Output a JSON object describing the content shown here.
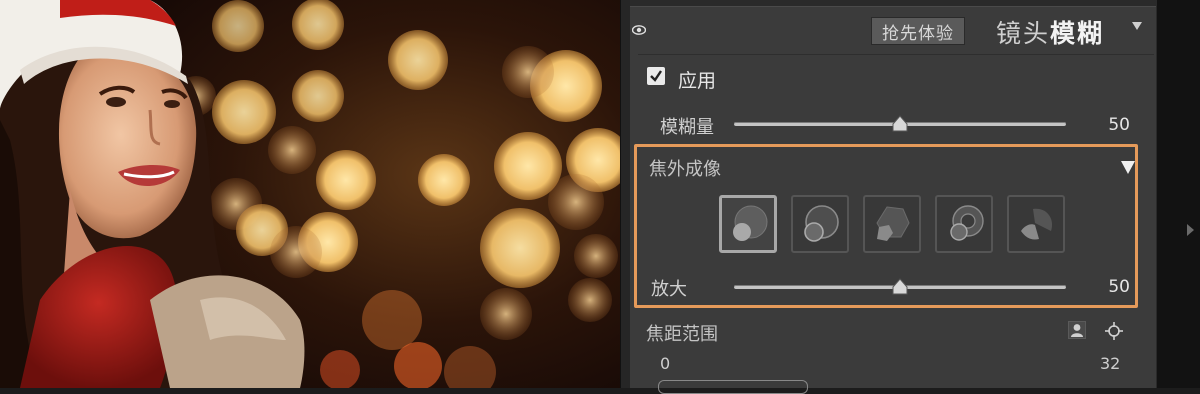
{
  "panel": {
    "preview_label": "抢先体验",
    "title_regular": "镜头",
    "title_bold": "模糊",
    "apply": {
      "label": "应用",
      "checked": true
    },
    "blur_amount": {
      "label": "模糊量",
      "value": "50",
      "level": 0.5
    },
    "bokeh": {
      "title": "焦外成像",
      "shapes": [
        "shape-circle",
        "shape-ring-circle",
        "shape-hexagon",
        "shape-cat-eye",
        "shape-crescent"
      ],
      "selected_index": 0,
      "zoom": {
        "label": "放大",
        "value": "50",
        "level": 0.5
      }
    },
    "focus_range": {
      "label": "焦距范围",
      "min": "0",
      "max": "32"
    }
  },
  "colors": {
    "highlight_border": "#e59a5a",
    "panel_bg": "#3b3b3b"
  }
}
